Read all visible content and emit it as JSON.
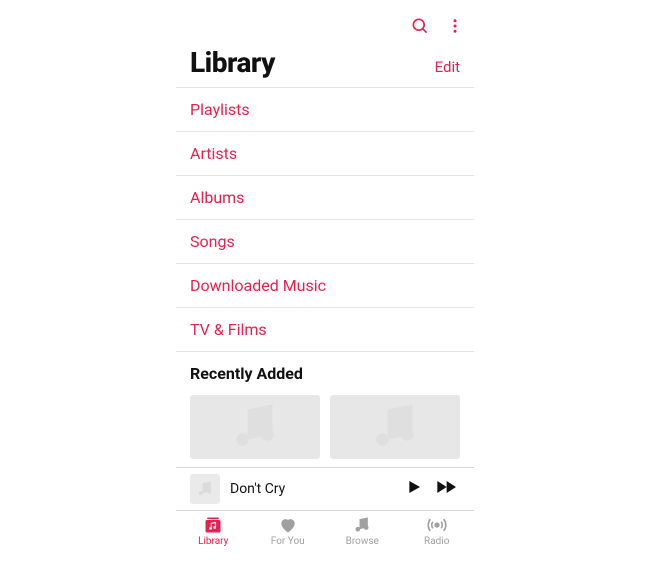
{
  "colors": {
    "accent": "#e6214e",
    "muted": "#a0a0a0"
  },
  "header": {
    "title": "Library",
    "edit": "Edit"
  },
  "categories": [
    "Playlists",
    "Artists",
    "Albums",
    "Songs",
    "Downloaded Music",
    "TV & Films"
  ],
  "section": {
    "recently_added": "Recently Added"
  },
  "nowplaying": {
    "title": "Don't Cry"
  },
  "tabs": {
    "library": "Library",
    "foryou": "For You",
    "browse": "Browse",
    "radio": "Radio"
  }
}
